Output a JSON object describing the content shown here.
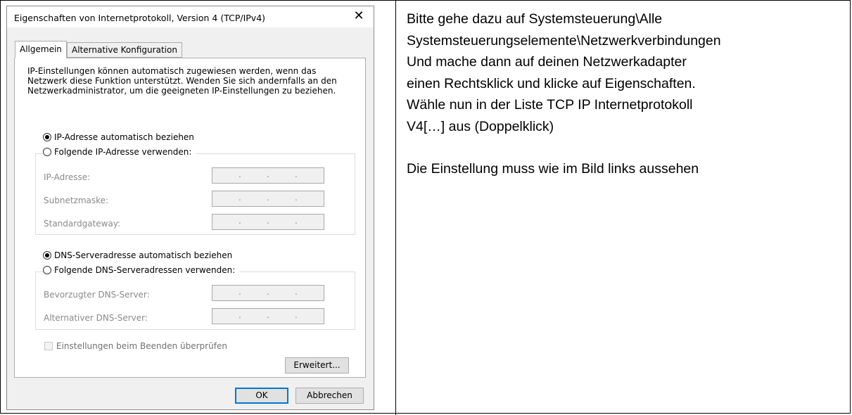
{
  "dialog": {
    "title": "Eigenschaften von Internetprotokoll, Version 4 (TCP/IPv4)",
    "close_glyph": "✕",
    "tabs": [
      {
        "label": "Allgemein",
        "active": true
      },
      {
        "label": "Alternative Konfiguration",
        "active": false
      }
    ],
    "description": "IP-Einstellungen können automatisch zugewiesen werden, wenn das Netzwerk diese Funktion unterstützt. Wenden Sie sich andernfalls an den Netzwerkadministrator, um die geeigneten IP-Einstellungen zu beziehen.",
    "ip_auto_label": "IP-Adresse automatisch beziehen",
    "ip_manual_label": "Folgende IP-Adresse verwenden:",
    "ip_fields": [
      {
        "label": "IP-Adresse:"
      },
      {
        "label": "Subnetzmaske:"
      },
      {
        "label": "Standardgateway:"
      }
    ],
    "dns_auto_label": "DNS-Serveradresse automatisch beziehen",
    "dns_manual_label": "Folgende DNS-Serveradressen verwenden:",
    "dns_fields": [
      {
        "label": "Bevorzugter DNS-Server:"
      },
      {
        "label": "Alternativer DNS-Server:"
      }
    ],
    "ip_dot": ".",
    "validate_label": "Einstellungen beim Beenden überprüfen",
    "advanced_button": "Erweitert...",
    "ok_button": "OK",
    "cancel_button": "Abbrechen"
  },
  "instructions": {
    "line1": "Bitte gehe dazu auf Systemsteuerung\\Alle",
    "line2": "Systemsteuerungselemente\\Netzwerkverbindungen",
    "line3": "Und mache dann auf deinen Netzwerkadapter",
    "line4": "einen Rechtsklick und klicke auf Eigenschaften.",
    "line5": "Wähle nun in der Liste TCP IP Internetprotokoll",
    "line6": "V4[…] aus (Doppelklick)",
    "line7": "Die Einstellung muss wie im Bild links aussehen"
  }
}
